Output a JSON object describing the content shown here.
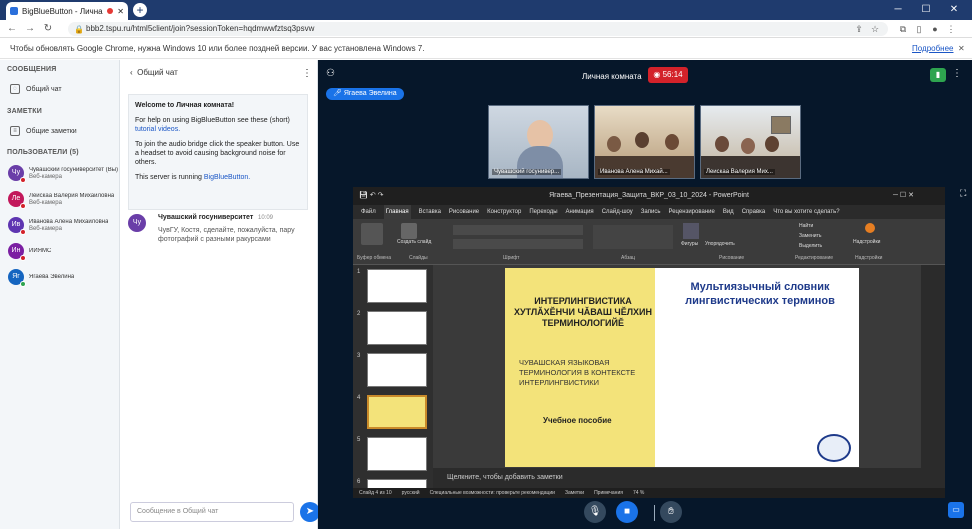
{
  "browser": {
    "tab_title": "BigBlueButton - Личная ком",
    "url": "bbb2.tspu.ru/html5client/join?sessionToken=hqdmwwfztsq3psvw",
    "banner_text": "Чтобы обновлять Google Chrome, нужна Windows 10 или более поздней версии. У вас установлена Windows 7.",
    "banner_link": "Подробнее"
  },
  "sidebar": {
    "messages_title": "СООБЩЕНИЯ",
    "public_chat": "Общий чат",
    "notes_title": "ЗАМЕТКИ",
    "shared_notes": "Общие заметки",
    "users_title": "ПОЛЬЗОВАТЕЛИ (5)",
    "users": [
      {
        "initials": "Чу",
        "name": "Чувашский госуниверситет (Вы)",
        "sub": "Веб-камера",
        "color": "#6a3ea8",
        "dot": "#d3222a"
      },
      {
        "initials": "Ле",
        "name": "Леискаа Валерия Михайловна",
        "sub": "Веб-камера",
        "color": "#c2185b",
        "dot": "#d3222a"
      },
      {
        "initials": "Ив",
        "name": "Иванова Алена Михайловна",
        "sub": "Веб-камера",
        "color": "#5e35b1",
        "dot": "#d3222a"
      },
      {
        "initials": "Ин",
        "name": "ИИЯМС",
        "sub": "",
        "color": "#7b1fa2",
        "dot": "#d3222a"
      },
      {
        "initials": "Яг",
        "name": "Ягаева Эвелина",
        "sub": "",
        "color": "#1565c0",
        "dot": "#2ea44f"
      }
    ]
  },
  "chat": {
    "header": "Общий чат",
    "welcome_title_prefix": "Welcome to ",
    "welcome_title_room": "Личная комната",
    "welcome_title_suffix": "!",
    "help_text": "For help on using BigBlueButton see these (short)",
    "help_link": "tutorial videos.",
    "audio_text": "To join the audio bridge click the speaker button. Use a headset to avoid causing background noise for others.",
    "server_text": "This server is running ",
    "server_link": "BigBlueButton.",
    "message": {
      "initials": "Чу",
      "author": "Чувашский госуниверситет",
      "time": "10:09",
      "text": "ЧувГУ, Костя, сделайте, пожалуйста, пару фотографий с разными ракурсами"
    },
    "input_placeholder": "Сообщение в Общий чат"
  },
  "main": {
    "room_title": "Личная комната",
    "timer": "56:14",
    "speaker": "Ягаева Эвелина",
    "cams": [
      {
        "label": "Чувашский госунивер..."
      },
      {
        "label": "Иванова Алена Михай..."
      },
      {
        "label": "Леискаа Валерия Мих..."
      }
    ]
  },
  "powerpoint": {
    "title": "Ягаева_Презентация_Защита_ВКР_03_10_2024 - PowerPoint",
    "menu": [
      "Файл",
      "Главная",
      "Вставка",
      "Рисование",
      "Конструктор",
      "Переходы",
      "Анимация",
      "Слайд-шоу",
      "Запись",
      "Рецензирование",
      "Вид",
      "Справка",
      "Что вы хотите сделать?"
    ],
    "ribbon_groups": [
      "Буфер обмена",
      "Слайды",
      "Шрифт",
      "Абзац",
      "Рисование",
      "Редактирование",
      "Надстройки"
    ],
    "ribbon_buttons": [
      "Создать слайд",
      "Фигуры",
      "Упорядочить",
      "Найти",
      "Заменить",
      "Выделить",
      "Надстройки"
    ],
    "slide_numbers": [
      "1",
      "2",
      "3",
      "4",
      "5",
      "6"
    ],
    "slide": {
      "left_title": "ИНТЕРЛИНГВИСТИКА ХУТЛĂХĔНЧИ ЧĂВАШ ЧĔЛХИН ТЕРМИНОЛОГИЙĔ",
      "left_subtitle": "ЧУВАШСКАЯ ЯЗЫКОВАЯ ТЕРМИНОЛОГИЯ В КОНТЕКСТЕ ИНТЕРЛИНГВИСТИКИ",
      "left_footer": "Учебное пособие",
      "right_title": "Мультиязычный словник лингвистических терминов"
    },
    "notes_placeholder": "Щелкните, чтобы добавить заметки",
    "status": [
      "Слайд 4 из 10",
      "русский",
      "Специальные возможности: проверьте рекомендации",
      "Заметки",
      "Примечания",
      "74 %"
    ]
  }
}
